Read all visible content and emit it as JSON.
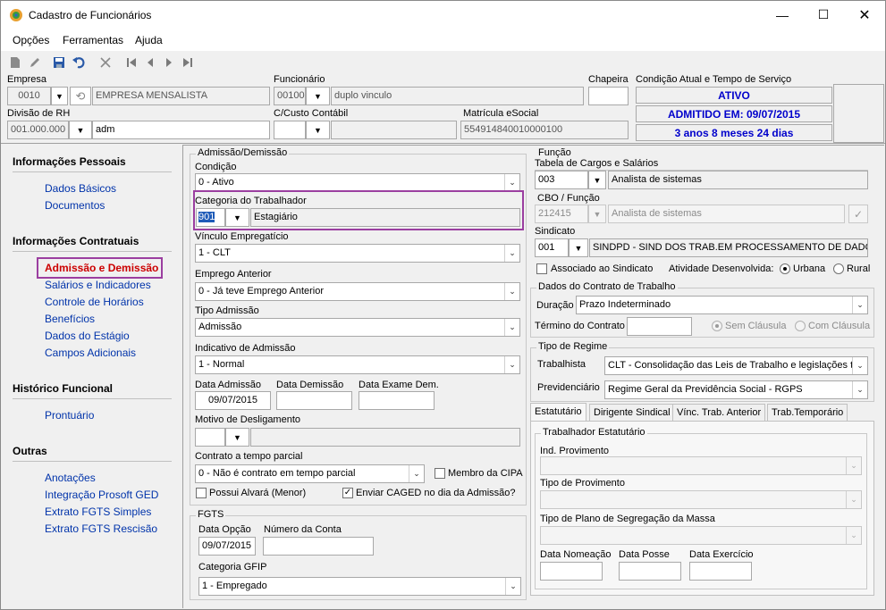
{
  "window": {
    "title": "Cadastro de Funcionários"
  },
  "menu": {
    "opcoes": "Opções",
    "ferramentas": "Ferramentas",
    "ajuda": "Ajuda"
  },
  "header": {
    "empresa_label": "Empresa",
    "empresa_code": "0010",
    "empresa_name": "EMPRESA MENSALISTA",
    "funcionario_label": "Funcionário",
    "funcionario_code": "00100",
    "funcionario_name": "duplo vinculo",
    "chapeira_label": "Chapeira",
    "chapeira_value": "",
    "divisao_label": "Divisão de RH",
    "divisao_code": "001.000.000",
    "divisao_name": "adm",
    "ccusto_label": "C/Custo Contábil",
    "matricula_label": "Matrícula eSocial",
    "matricula_value": "554914840010000100",
    "condicao_title": "Condição Atual e Tempo de Serviço",
    "status_ativo": "ATIVO",
    "status_admitido": "ADMITIDO EM: 09/07/2015",
    "status_tempo": "3 anos 8 meses 24 dias"
  },
  "nav": {
    "pessoais": "Informações Pessoais",
    "dados_basicos": "Dados Básicos",
    "documentos": "Documentos",
    "contratuais": "Informações Contratuais",
    "admissao": "Admissão e Demissão",
    "salarios": "Salários e Indicadores",
    "horarios": "Controle de Horários",
    "beneficios": "Benefícios",
    "estagio": "Dados do Estágio",
    "adicionais": "Campos Adicionais",
    "historico": "Histórico Funcional",
    "prontuario": "Prontuário",
    "outras": "Outras",
    "anotacoes": "Anotações",
    "ged": "Integração Prosoft GED",
    "fgts_simples": "Extrato FGTS Simples",
    "fgts_rescisao": "Extrato FGTS Rescisão"
  },
  "admissao": {
    "group_title": "Admissão/Demissão",
    "condicao_label": "Condição",
    "condicao_value": "0 - Ativo",
    "categoria_label": "Categoria do Trabalhador",
    "categoria_code": "901",
    "categoria_name": "Estagiário",
    "vinculo_label": "Vínculo Empregatício",
    "vinculo_value": "1 - CLT",
    "emprego_anterior_label": "Emprego Anterior",
    "emprego_anterior_value": "0 - Já teve Emprego Anterior",
    "tipo_admissao_label": "Tipo Admissão",
    "tipo_admissao_value": "Admissão",
    "indicativo_label": "Indicativo de Admissão",
    "indicativo_value": "1 - Normal",
    "data_admissao_label": "Data Admissão",
    "data_admissao_value": "09/07/2015",
    "data_demissao_label": "Data Demissão",
    "data_exame_label": "Data Exame Dem.",
    "motivo_label": "Motivo de Desligamento",
    "contrato_parcial_label": "Contrato a tempo parcial",
    "contrato_parcial_value": "0 - Não é contrato em tempo parcial",
    "membro_cipa_label": "Membro da CIPA",
    "alvara_label": "Possui Alvará (Menor)",
    "caged_label": "Enviar CAGED no dia da Admissão?"
  },
  "fgts": {
    "group_title": "FGTS",
    "data_opcao_label": "Data Opção",
    "data_opcao_value": "09/07/2015",
    "numero_conta_label": "Número da Conta",
    "categoria_gfip_label": "Categoria GFIP",
    "categoria_gfip_value": "1 - Empregado"
  },
  "funcao": {
    "group_title": "Função",
    "tabela_label": "Tabela de Cargos e Salários",
    "tabela_code": "003",
    "tabela_name": "Analista de sistemas",
    "cbo_label": "CBO / Função",
    "cbo_code": "212415",
    "cbo_name": "Analista de sistemas",
    "sindicato_label": "Sindicato",
    "sindicato_code": "001",
    "sindicato_name": "SINDPD - SIND DOS TRAB.EM PROCESSAMENTO DE DADOS EST",
    "associado_label": "Associado ao Sindicato",
    "atividade_label": "Atividade Desenvolvida:",
    "urbana_label": "Urbana",
    "rural_label": "Rural"
  },
  "contrato": {
    "group_title": "Dados do Contrato de Trabalho",
    "duracao_label": "Duração",
    "duracao_value": "Prazo Indeterminado",
    "termino_label": "Término do Contrato",
    "sem_clausula_label": "Sem Cláusula",
    "com_clausula_label": "Com Cláusula"
  },
  "regime": {
    "group_title": "Tipo de Regime",
    "trabalhista_label": "Trabalhista",
    "trabalhista_value": "CLT - Consolidação das Leis de Trabalho e legislações tra",
    "previdenciario_label": "Previdenciário",
    "previdenciario_value": "Regime Geral da Previdência Social - RGPS"
  },
  "tabs": {
    "estatutario": "Estatutário",
    "dirigente": "Dirigente Sindical",
    "vinc_trab": "Vínc. Trab. Anterior",
    "trab_temp": "Trab.Temporário"
  },
  "estatutario": {
    "group_title": "Trabalhador Estatutário",
    "ind_provimento_label": "Ind. Provimento",
    "tipo_provimento_label": "Tipo de Provimento",
    "tipo_plano_label": "Tipo de Plano de Segregação da Massa",
    "data_nomeacao_label": "Data Nomeação",
    "data_posse_label": "Data Posse",
    "data_exercicio_label": "Data Exercício"
  },
  "colors": {
    "link": "#0033aa",
    "highlight_border": "#9b3ea0",
    "status_text": "#0000cc",
    "active_red": "#cc0000"
  }
}
